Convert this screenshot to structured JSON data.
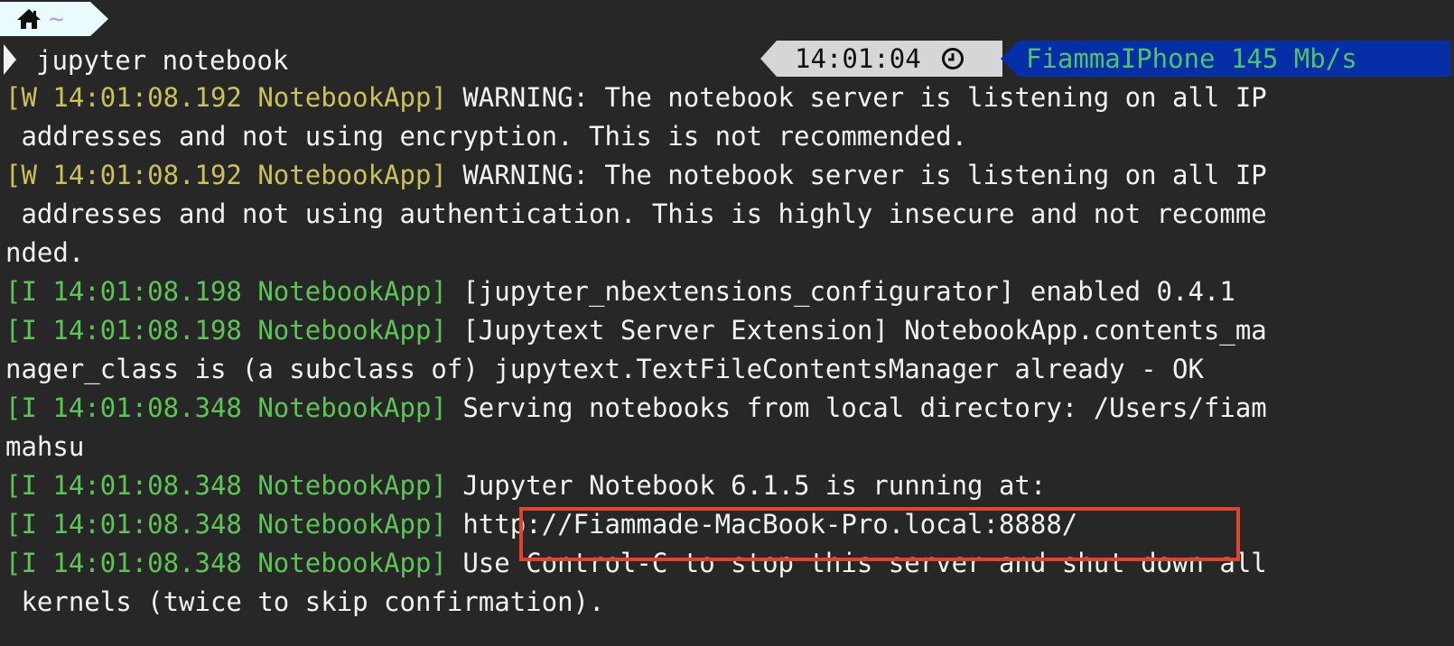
{
  "prompt": {
    "home_icon": "home-icon",
    "tilde": "~",
    "command": "jupyter notebook"
  },
  "status": {
    "time": "14:01:04",
    "clock_icon": "clock-icon",
    "network": "FiammaIPhone 145 Mb/s"
  },
  "log_lines": [
    {
      "prefix": "[W 14:01:08.192 NotebookApp]",
      "message": " WARNING: The notebook server is listening on all IP"
    },
    {
      "prefix": "",
      "message": " addresses and not using encryption. This is not recommended."
    },
    {
      "prefix": "[W 14:01:08.192 NotebookApp]",
      "message": " WARNING: The notebook server is listening on all IP"
    },
    {
      "prefix": "",
      "message": " addresses and not using authentication. This is highly insecure and not recomme"
    },
    {
      "prefix": "",
      "message": "nded."
    },
    {
      "prefix": "[I 14:01:08.198 NotebookApp]",
      "message": " [jupyter_nbextensions_configurator] enabled 0.4.1"
    },
    {
      "prefix": "[I 14:01:08.198 NotebookApp]",
      "message": " [Jupytext Server Extension] NotebookApp.contents_ma"
    },
    {
      "prefix": "",
      "message": "nager_class is (a subclass of) jupytext.TextFileContentsManager already - OK"
    },
    {
      "prefix": "[I 14:01:08.348 NotebookApp]",
      "message": " Serving notebooks from local directory: /Users/fiam"
    },
    {
      "prefix": "",
      "message": "mahsu"
    },
    {
      "prefix": "[I 14:01:08.348 NotebookApp]",
      "message": " Jupyter Notebook 6.1.5 is running at:"
    },
    {
      "prefix": "[I 14:01:08.348 NotebookApp]",
      "message": " http://Fiammade-MacBook-Pro.local:8888/"
    },
    {
      "prefix": "[I 14:01:08.348 NotebookApp]",
      "message": " Use Control-C to stop this server and shut down all"
    },
    {
      "prefix": "",
      "message": " kernels (twice to skip confirmation)."
    }
  ]
}
